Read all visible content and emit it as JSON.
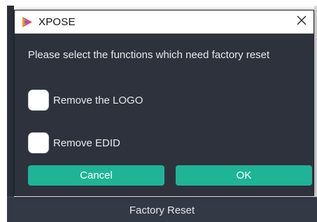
{
  "window": {
    "title": "XPOSE",
    "close_icon": "close-icon",
    "app_icon": "xpose-logo-icon"
  },
  "dialog": {
    "prompt": "Please select the functions which need factory reset",
    "options": [
      {
        "label": "Remove the LOGO",
        "checked": false
      },
      {
        "label": "Remove EDID",
        "checked": false
      }
    ],
    "cancel_label": "Cancel",
    "ok_label": "OK"
  },
  "background_app": {
    "bottom_label": "Factory Reset"
  },
  "colors": {
    "dialog_bg": "#2e323c",
    "accent": "#1fb496",
    "titlebar_bg": "#ffffff",
    "text": "#e8eaee"
  }
}
